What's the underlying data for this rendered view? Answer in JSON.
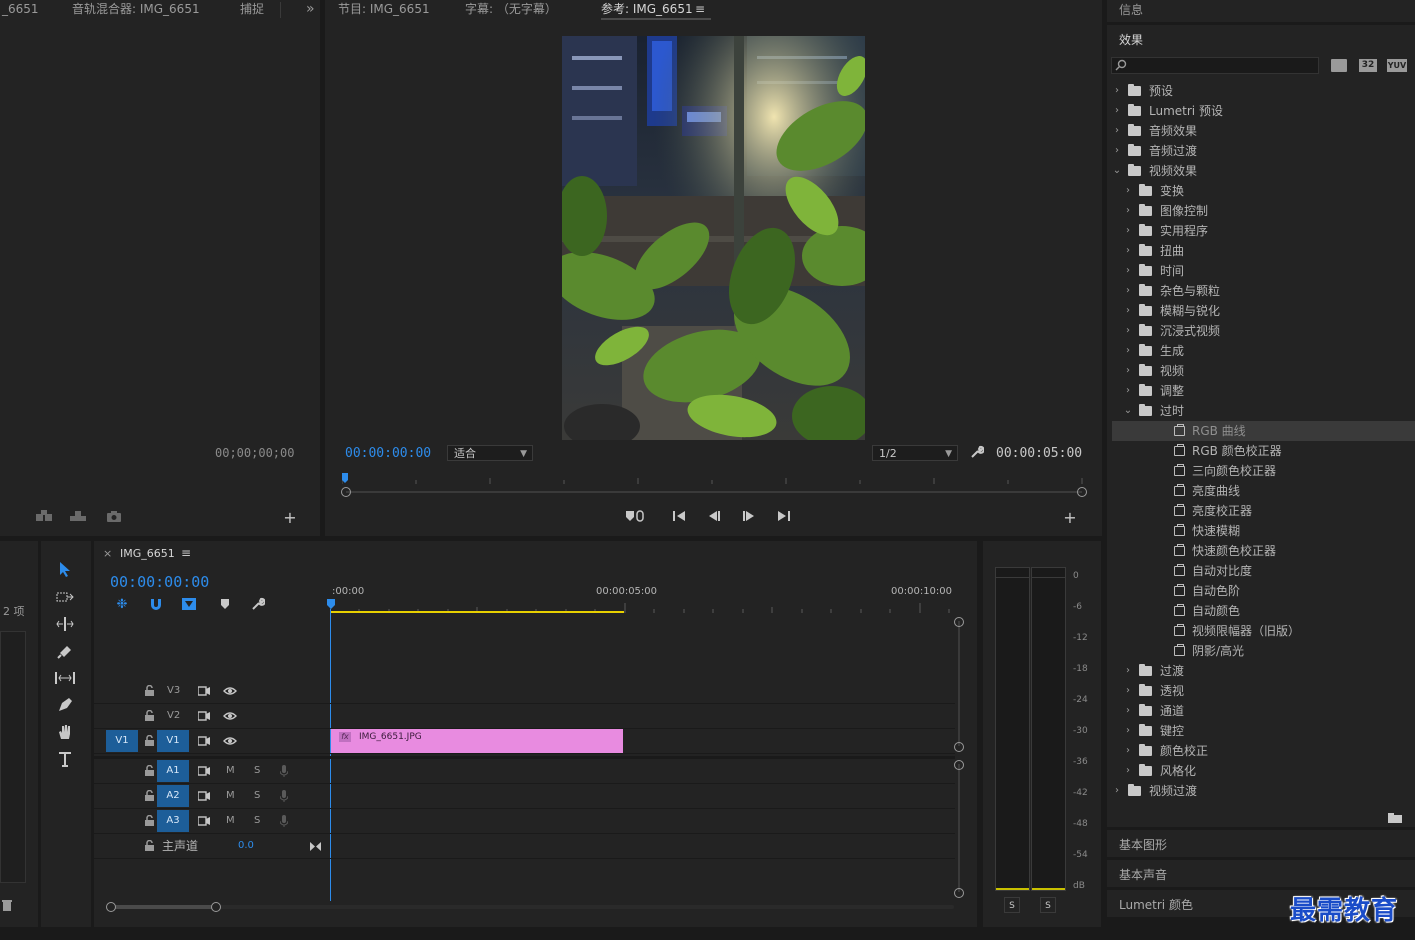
{
  "source_panel": {
    "tabs": [
      "_6651",
      "音轨混合器: IMG_6651",
      "捕捉"
    ],
    "overflow": "»",
    "timecode": "00;00;00;00"
  },
  "program_panel": {
    "tabs": [
      "节目: IMG_6651",
      "字幕: （无字幕）",
      "参考: IMG_6651"
    ],
    "menu_icon": "≡",
    "current_time": "00:00:00:00",
    "fit_value": "适合",
    "resolution": "1/2",
    "duration": "00:00:05:00"
  },
  "right_panel": {
    "info_title": "信息",
    "effects_title": "效果",
    "search_placeholder": "",
    "badges": [
      "32",
      "YUV"
    ],
    "tree": [
      {
        "label": "预设",
        "level": 0,
        "type": "preset",
        "state": "collapsed"
      },
      {
        "label": "Lumetri 预设",
        "level": 0,
        "type": "preset",
        "state": "collapsed"
      },
      {
        "label": "音频效果",
        "level": 0,
        "type": "folder",
        "state": "collapsed"
      },
      {
        "label": "音频过渡",
        "level": 0,
        "type": "folder",
        "state": "collapsed"
      },
      {
        "label": "视频效果",
        "level": 0,
        "type": "folder",
        "state": "expanded"
      },
      {
        "label": "变换",
        "level": 1,
        "type": "folder",
        "state": "collapsed"
      },
      {
        "label": "图像控制",
        "level": 1,
        "type": "folder",
        "state": "collapsed"
      },
      {
        "label": "实用程序",
        "level": 1,
        "type": "folder",
        "state": "collapsed"
      },
      {
        "label": "扭曲",
        "level": 1,
        "type": "folder",
        "state": "collapsed"
      },
      {
        "label": "时间",
        "level": 1,
        "type": "folder",
        "state": "collapsed"
      },
      {
        "label": "杂色与颗粒",
        "level": 1,
        "type": "folder",
        "state": "collapsed"
      },
      {
        "label": "模糊与锐化",
        "level": 1,
        "type": "folder",
        "state": "collapsed"
      },
      {
        "label": "沉浸式视频",
        "level": 1,
        "type": "folder",
        "state": "collapsed"
      },
      {
        "label": "生成",
        "level": 1,
        "type": "folder",
        "state": "collapsed"
      },
      {
        "label": "视频",
        "level": 1,
        "type": "folder",
        "state": "collapsed"
      },
      {
        "label": "调整",
        "level": 1,
        "type": "folder",
        "state": "collapsed"
      },
      {
        "label": "过时",
        "level": 1,
        "type": "folder",
        "state": "expanded"
      },
      {
        "label": "RGB 曲线",
        "level": 2,
        "type": "effect",
        "state": "selected"
      },
      {
        "label": "RGB 颜色校正器",
        "level": 2,
        "type": "effect",
        "state": ""
      },
      {
        "label": "三向颜色校正器",
        "level": 2,
        "type": "effect",
        "state": ""
      },
      {
        "label": "亮度曲线",
        "level": 2,
        "type": "effect",
        "state": ""
      },
      {
        "label": "亮度校正器",
        "level": 2,
        "type": "effect",
        "state": ""
      },
      {
        "label": "快速模糊",
        "level": 2,
        "type": "effect",
        "state": ""
      },
      {
        "label": "快速颜色校正器",
        "level": 2,
        "type": "effect",
        "state": ""
      },
      {
        "label": "自动对比度",
        "level": 2,
        "type": "effect",
        "state": ""
      },
      {
        "label": "自动色阶",
        "level": 2,
        "type": "effect",
        "state": ""
      },
      {
        "label": "自动颜色",
        "level": 2,
        "type": "effect",
        "state": ""
      },
      {
        "label": "视频限幅器（旧版）",
        "level": 2,
        "type": "effect",
        "state": ""
      },
      {
        "label": "阴影/高光",
        "level": 2,
        "type": "effect",
        "state": ""
      },
      {
        "label": "过渡",
        "level": 1,
        "type": "folder",
        "state": "collapsed"
      },
      {
        "label": "透视",
        "level": 1,
        "type": "folder",
        "state": "collapsed"
      },
      {
        "label": "通道",
        "level": 1,
        "type": "folder",
        "state": "collapsed"
      },
      {
        "label": "键控",
        "level": 1,
        "type": "folder",
        "state": "collapsed"
      },
      {
        "label": "颜色校正",
        "level": 1,
        "type": "folder",
        "state": "collapsed"
      },
      {
        "label": "风格化",
        "level": 1,
        "type": "folder",
        "state": "collapsed"
      },
      {
        "label": "视频过渡",
        "level": 0,
        "type": "folder",
        "state": "collapsed"
      }
    ],
    "bottom_panels": [
      "基本图形",
      "基本声音",
      "Lumetri 颜色"
    ]
  },
  "project_panel": {
    "items_count": "2 项"
  },
  "timeline": {
    "close": "×",
    "sequence_name": "IMG_6651",
    "menu_icon": "≡",
    "timecode": "00:00:00:00",
    "ruler_labels": [
      ":00:00",
      "00:00:05:00",
      "00:00:10:00"
    ],
    "video_tracks": [
      {
        "name": "V3",
        "source": ""
      },
      {
        "name": "V2",
        "source": ""
      },
      {
        "name": "V1",
        "source": "V1"
      }
    ],
    "audio_tracks": [
      {
        "name": "A1",
        "m": "M",
        "s": "S"
      },
      {
        "name": "A2",
        "m": "M",
        "s": "S"
      },
      {
        "name": "A3",
        "m": "M",
        "s": "S"
      }
    ],
    "master": {
      "label": "主声道",
      "value": "0.0"
    },
    "clip": {
      "badge": "fx",
      "name": "IMG_6651.JPG",
      "color": "#e88be0"
    }
  },
  "audio_meter": {
    "scale": [
      "0",
      "-6",
      "-12",
      "-18",
      "-24",
      "-30",
      "-36",
      "-42",
      "-48",
      "-54",
      "dB"
    ],
    "solo": [
      "S",
      "S"
    ]
  },
  "watermark": "最需教育",
  "colors": {
    "accent_blue": "#2d8ceb",
    "track_blue": "#1d5e99",
    "clip_pink": "#e88be0",
    "work_area_yellow": "#e8d000",
    "watermark_blue": "#1a4cc8"
  }
}
